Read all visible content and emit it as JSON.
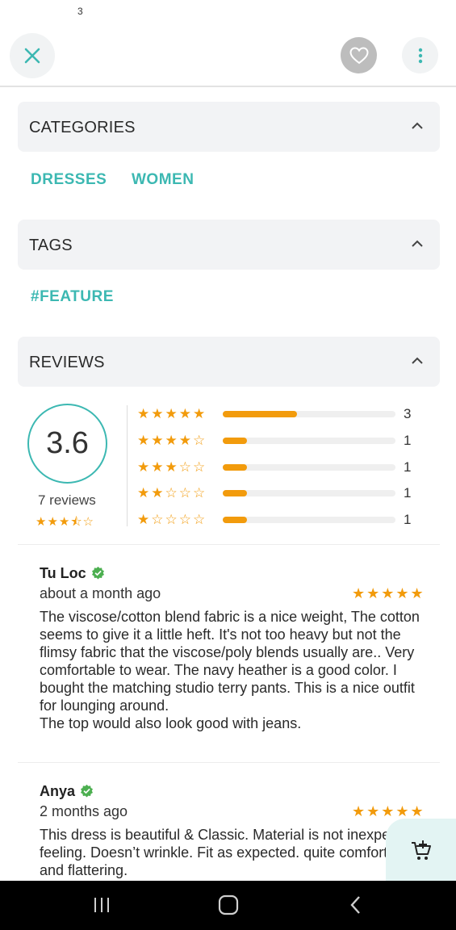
{
  "status_bar": {
    "indicator": "3"
  },
  "toolbar": {
    "close_icon": "close-icon",
    "favorite_icon": "heart-icon",
    "more_icon": "more-vertical-icon"
  },
  "sections": {
    "categories": {
      "title": "CATEGORIES",
      "items": [
        "DRESSES",
        "WOMEN"
      ]
    },
    "tags": {
      "title": "TAGS",
      "items": [
        "#FEATURE"
      ]
    },
    "reviews": {
      "title": "REVIEWS"
    }
  },
  "rating_summary": {
    "average": "3.6",
    "count_label": "7 reviews",
    "average_stars": 3.5,
    "breakdown": [
      {
        "stars": 5,
        "count": "3",
        "fraction": 0.43
      },
      {
        "stars": 4,
        "count": "1",
        "fraction": 0.14
      },
      {
        "stars": 3,
        "count": "1",
        "fraction": 0.14
      },
      {
        "stars": 2,
        "count": "1",
        "fraction": 0.14
      },
      {
        "stars": 1,
        "count": "1",
        "fraction": 0.14
      }
    ]
  },
  "reviews": [
    {
      "name": "Tu Loc",
      "verified": true,
      "date": "about a month ago",
      "rating": 5,
      "text": "The viscose/cotton blend fabric is a nice weight, The cotton seems to give it a little heft. It's not too heavy but not the flimsy fabric that the viscose/poly blends usually are.. Very comfortable to wear. The navy heather is a good color. I bought the matching studio terry pants. This is a nice outfit for lounging around.\nThe top would also look good with jeans."
    },
    {
      "name": "Anya",
      "verified": true,
      "date": "2 months ago",
      "rating": 5,
      "text": "This dress is beautiful & Classic. Material is not inexpensive feeling. Doesn’t wrinkle. Fit as expected. quite comfortable and flattering."
    }
  ],
  "colors": {
    "accent": "#3cb8b2",
    "star": "#f29b0c",
    "verified": "#4caf50",
    "header_bg": "#f2f3f5"
  },
  "nav_bar": {
    "recents_icon": "recents-icon",
    "home_icon": "home-icon",
    "back_icon": "back-icon"
  },
  "fab": {
    "icon": "add-to-cart-icon"
  }
}
